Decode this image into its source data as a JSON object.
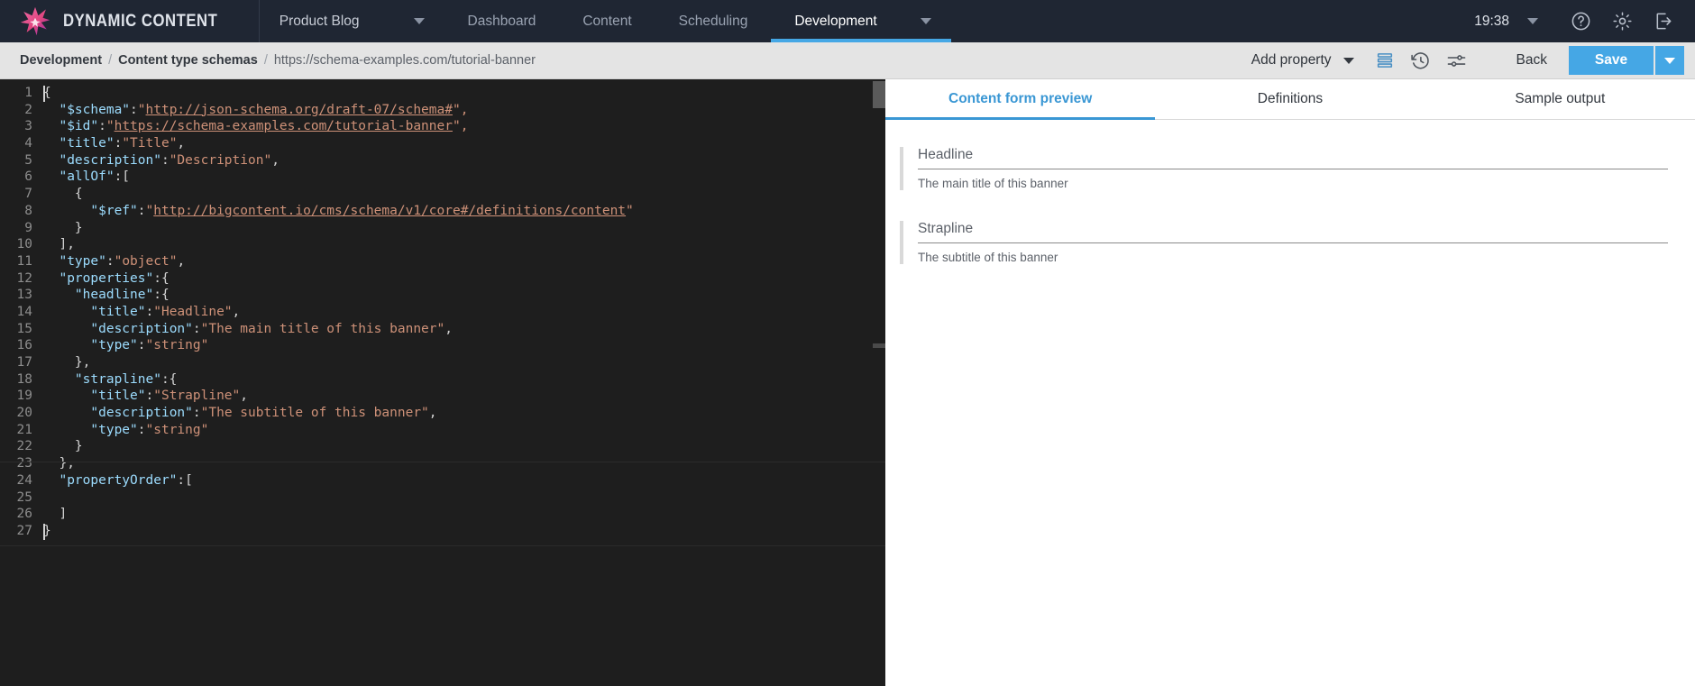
{
  "topnav": {
    "brand_name": "DYNAMIC CONTENT",
    "logo_icon": "star-burst-logo",
    "hub": {
      "name": "Product Blog",
      "caret_icon": "chevron-down-icon"
    },
    "items": [
      {
        "label": "Dashboard",
        "active": false,
        "has_caret": false
      },
      {
        "label": "Content",
        "active": false,
        "has_caret": false
      },
      {
        "label": "Scheduling",
        "active": false,
        "has_caret": false
      },
      {
        "label": "Development",
        "active": true,
        "has_caret": true
      }
    ],
    "clock": "19:38",
    "clock_caret_icon": "chevron-down-icon",
    "help_icon": "question-circle-icon",
    "settings_icon": "gear-icon",
    "logout_icon": "sign-out-icon",
    "active_underline_color": "#45a7e5",
    "background_color": "#1f2633"
  },
  "breadcrumb": {
    "items": [
      "Development",
      "Content type schemas",
      "https://schema-examples.com/tutorial-banner"
    ],
    "separator": "/"
  },
  "toolbar": {
    "add_property_label": "Add property",
    "add_property_caret_icon": "chevron-down-icon",
    "layout_icon": "list-layout-icon",
    "history_icon": "history-clock-icon",
    "settings_sliders_icon": "sliders-icon",
    "back_label": "Back",
    "save_label": "Save",
    "save_caret_icon": "chevron-down-icon",
    "save_color": "#45a7e5"
  },
  "editor": {
    "background_color": "#1e1e1e",
    "key_color": "#9cdcfe",
    "string_color": "#ce9178",
    "punctuation_color": "#d4d4d4",
    "line_number_color": "#8d8d8d",
    "first_line": 1,
    "last_line": 27,
    "lines": [
      {
        "n": 1,
        "segments": [
          {
            "t": "{",
            "c": "p"
          }
        ]
      },
      {
        "n": 2,
        "segments": [
          {
            "t": "  ",
            "c": "p"
          },
          {
            "t": "\"$schema\"",
            "c": "k"
          },
          {
            "t": ":",
            "c": "p"
          },
          {
            "t": "\"",
            "c": "s"
          },
          {
            "t": "http://json-schema.org/draft-07/schema#",
            "c": "u"
          },
          {
            "t": "\",",
            "c": "s"
          }
        ]
      },
      {
        "n": 3,
        "segments": [
          {
            "t": "  ",
            "c": "p"
          },
          {
            "t": "\"$id\"",
            "c": "k"
          },
          {
            "t": ":",
            "c": "p"
          },
          {
            "t": "\"",
            "c": "s"
          },
          {
            "t": "https://schema-examples.com/tutorial-banner",
            "c": "u"
          },
          {
            "t": "\",",
            "c": "s"
          }
        ]
      },
      {
        "n": 4,
        "segments": [
          {
            "t": "  ",
            "c": "p"
          },
          {
            "t": "\"title\"",
            "c": "k"
          },
          {
            "t": ":",
            "c": "p"
          },
          {
            "t": "\"Title\"",
            "c": "s"
          },
          {
            "t": ",",
            "c": "p"
          }
        ]
      },
      {
        "n": 5,
        "segments": [
          {
            "t": "  ",
            "c": "p"
          },
          {
            "t": "\"description\"",
            "c": "k"
          },
          {
            "t": ":",
            "c": "p"
          },
          {
            "t": "\"Description\"",
            "c": "s"
          },
          {
            "t": ",",
            "c": "p"
          }
        ]
      },
      {
        "n": 6,
        "segments": [
          {
            "t": "  ",
            "c": "p"
          },
          {
            "t": "\"allOf\"",
            "c": "k"
          },
          {
            "t": ":[",
            "c": "p"
          }
        ]
      },
      {
        "n": 7,
        "segments": [
          {
            "t": "    {",
            "c": "p"
          }
        ]
      },
      {
        "n": 8,
        "segments": [
          {
            "t": "      ",
            "c": "p"
          },
          {
            "t": "\"$ref\"",
            "c": "k"
          },
          {
            "t": ":",
            "c": "p"
          },
          {
            "t": "\"",
            "c": "s"
          },
          {
            "t": "http://bigcontent.io/cms/schema/v1/core#/definitions/content",
            "c": "u"
          },
          {
            "t": "\"",
            "c": "s"
          }
        ]
      },
      {
        "n": 9,
        "segments": [
          {
            "t": "    }",
            "c": "p"
          }
        ]
      },
      {
        "n": 10,
        "segments": [
          {
            "t": "  ],",
            "c": "p"
          }
        ]
      },
      {
        "n": 11,
        "segments": [
          {
            "t": "  ",
            "c": "p"
          },
          {
            "t": "\"type\"",
            "c": "k"
          },
          {
            "t": ":",
            "c": "p"
          },
          {
            "t": "\"object\"",
            "c": "s"
          },
          {
            "t": ",",
            "c": "p"
          }
        ]
      },
      {
        "n": 12,
        "segments": [
          {
            "t": "  ",
            "c": "p"
          },
          {
            "t": "\"properties\"",
            "c": "k"
          },
          {
            "t": ":{",
            "c": "p"
          }
        ]
      },
      {
        "n": 13,
        "segments": [
          {
            "t": "    ",
            "c": "p"
          },
          {
            "t": "\"headline\"",
            "c": "k"
          },
          {
            "t": ":{",
            "c": "p"
          }
        ]
      },
      {
        "n": 14,
        "segments": [
          {
            "t": "      ",
            "c": "p"
          },
          {
            "t": "\"title\"",
            "c": "k"
          },
          {
            "t": ":",
            "c": "p"
          },
          {
            "t": "\"Headline\"",
            "c": "s"
          },
          {
            "t": ",",
            "c": "p"
          }
        ]
      },
      {
        "n": 15,
        "segments": [
          {
            "t": "      ",
            "c": "p"
          },
          {
            "t": "\"description\"",
            "c": "k"
          },
          {
            "t": ":",
            "c": "p"
          },
          {
            "t": "\"The main title of this banner\"",
            "c": "s"
          },
          {
            "t": ",",
            "c": "p"
          }
        ]
      },
      {
        "n": 16,
        "segments": [
          {
            "t": "      ",
            "c": "p"
          },
          {
            "t": "\"type\"",
            "c": "k"
          },
          {
            "t": ":",
            "c": "p"
          },
          {
            "t": "\"string\"",
            "c": "s"
          }
        ]
      },
      {
        "n": 17,
        "segments": [
          {
            "t": "    },",
            "c": "p"
          }
        ]
      },
      {
        "n": 18,
        "segments": [
          {
            "t": "    ",
            "c": "p"
          },
          {
            "t": "\"strapline\"",
            "c": "k"
          },
          {
            "t": ":{",
            "c": "p"
          }
        ]
      },
      {
        "n": 19,
        "segments": [
          {
            "t": "      ",
            "c": "p"
          },
          {
            "t": "\"title\"",
            "c": "k"
          },
          {
            "t": ":",
            "c": "p"
          },
          {
            "t": "\"Strapline\"",
            "c": "s"
          },
          {
            "t": ",",
            "c": "p"
          }
        ]
      },
      {
        "n": 20,
        "segments": [
          {
            "t": "      ",
            "c": "p"
          },
          {
            "t": "\"description\"",
            "c": "k"
          },
          {
            "t": ":",
            "c": "p"
          },
          {
            "t": "\"The subtitle of this banner\"",
            "c": "s"
          },
          {
            "t": ",",
            "c": "p"
          }
        ]
      },
      {
        "n": 21,
        "segments": [
          {
            "t": "      ",
            "c": "p"
          },
          {
            "t": "\"type\"",
            "c": "k"
          },
          {
            "t": ":",
            "c": "p"
          },
          {
            "t": "\"string\"",
            "c": "s"
          }
        ]
      },
      {
        "n": 22,
        "segments": [
          {
            "t": "    }",
            "c": "p"
          }
        ]
      },
      {
        "n": 23,
        "segments": [
          {
            "t": "  },",
            "c": "p"
          }
        ]
      },
      {
        "n": 24,
        "segments": [
          {
            "t": "  ",
            "c": "p"
          },
          {
            "t": "\"propertyOrder\"",
            "c": "k"
          },
          {
            "t": ":[",
            "c": "p"
          }
        ]
      },
      {
        "n": 25,
        "segments": [
          {
            "t": "",
            "c": "p"
          }
        ]
      },
      {
        "n": 26,
        "segments": [
          {
            "t": "  ]",
            "c": "p"
          }
        ]
      },
      {
        "n": 27,
        "segments": [
          {
            "t": "}",
            "c": "p"
          }
        ]
      }
    ]
  },
  "preview": {
    "tabs": [
      {
        "label": "Content form preview",
        "active": true
      },
      {
        "label": "Definitions",
        "active": false
      },
      {
        "label": "Sample output",
        "active": false
      }
    ],
    "active_tab_color": "#3a97d4",
    "fields": [
      {
        "label": "Headline",
        "help": "The main title of this banner"
      },
      {
        "label": "Strapline",
        "help": "The subtitle of this banner"
      }
    ]
  }
}
